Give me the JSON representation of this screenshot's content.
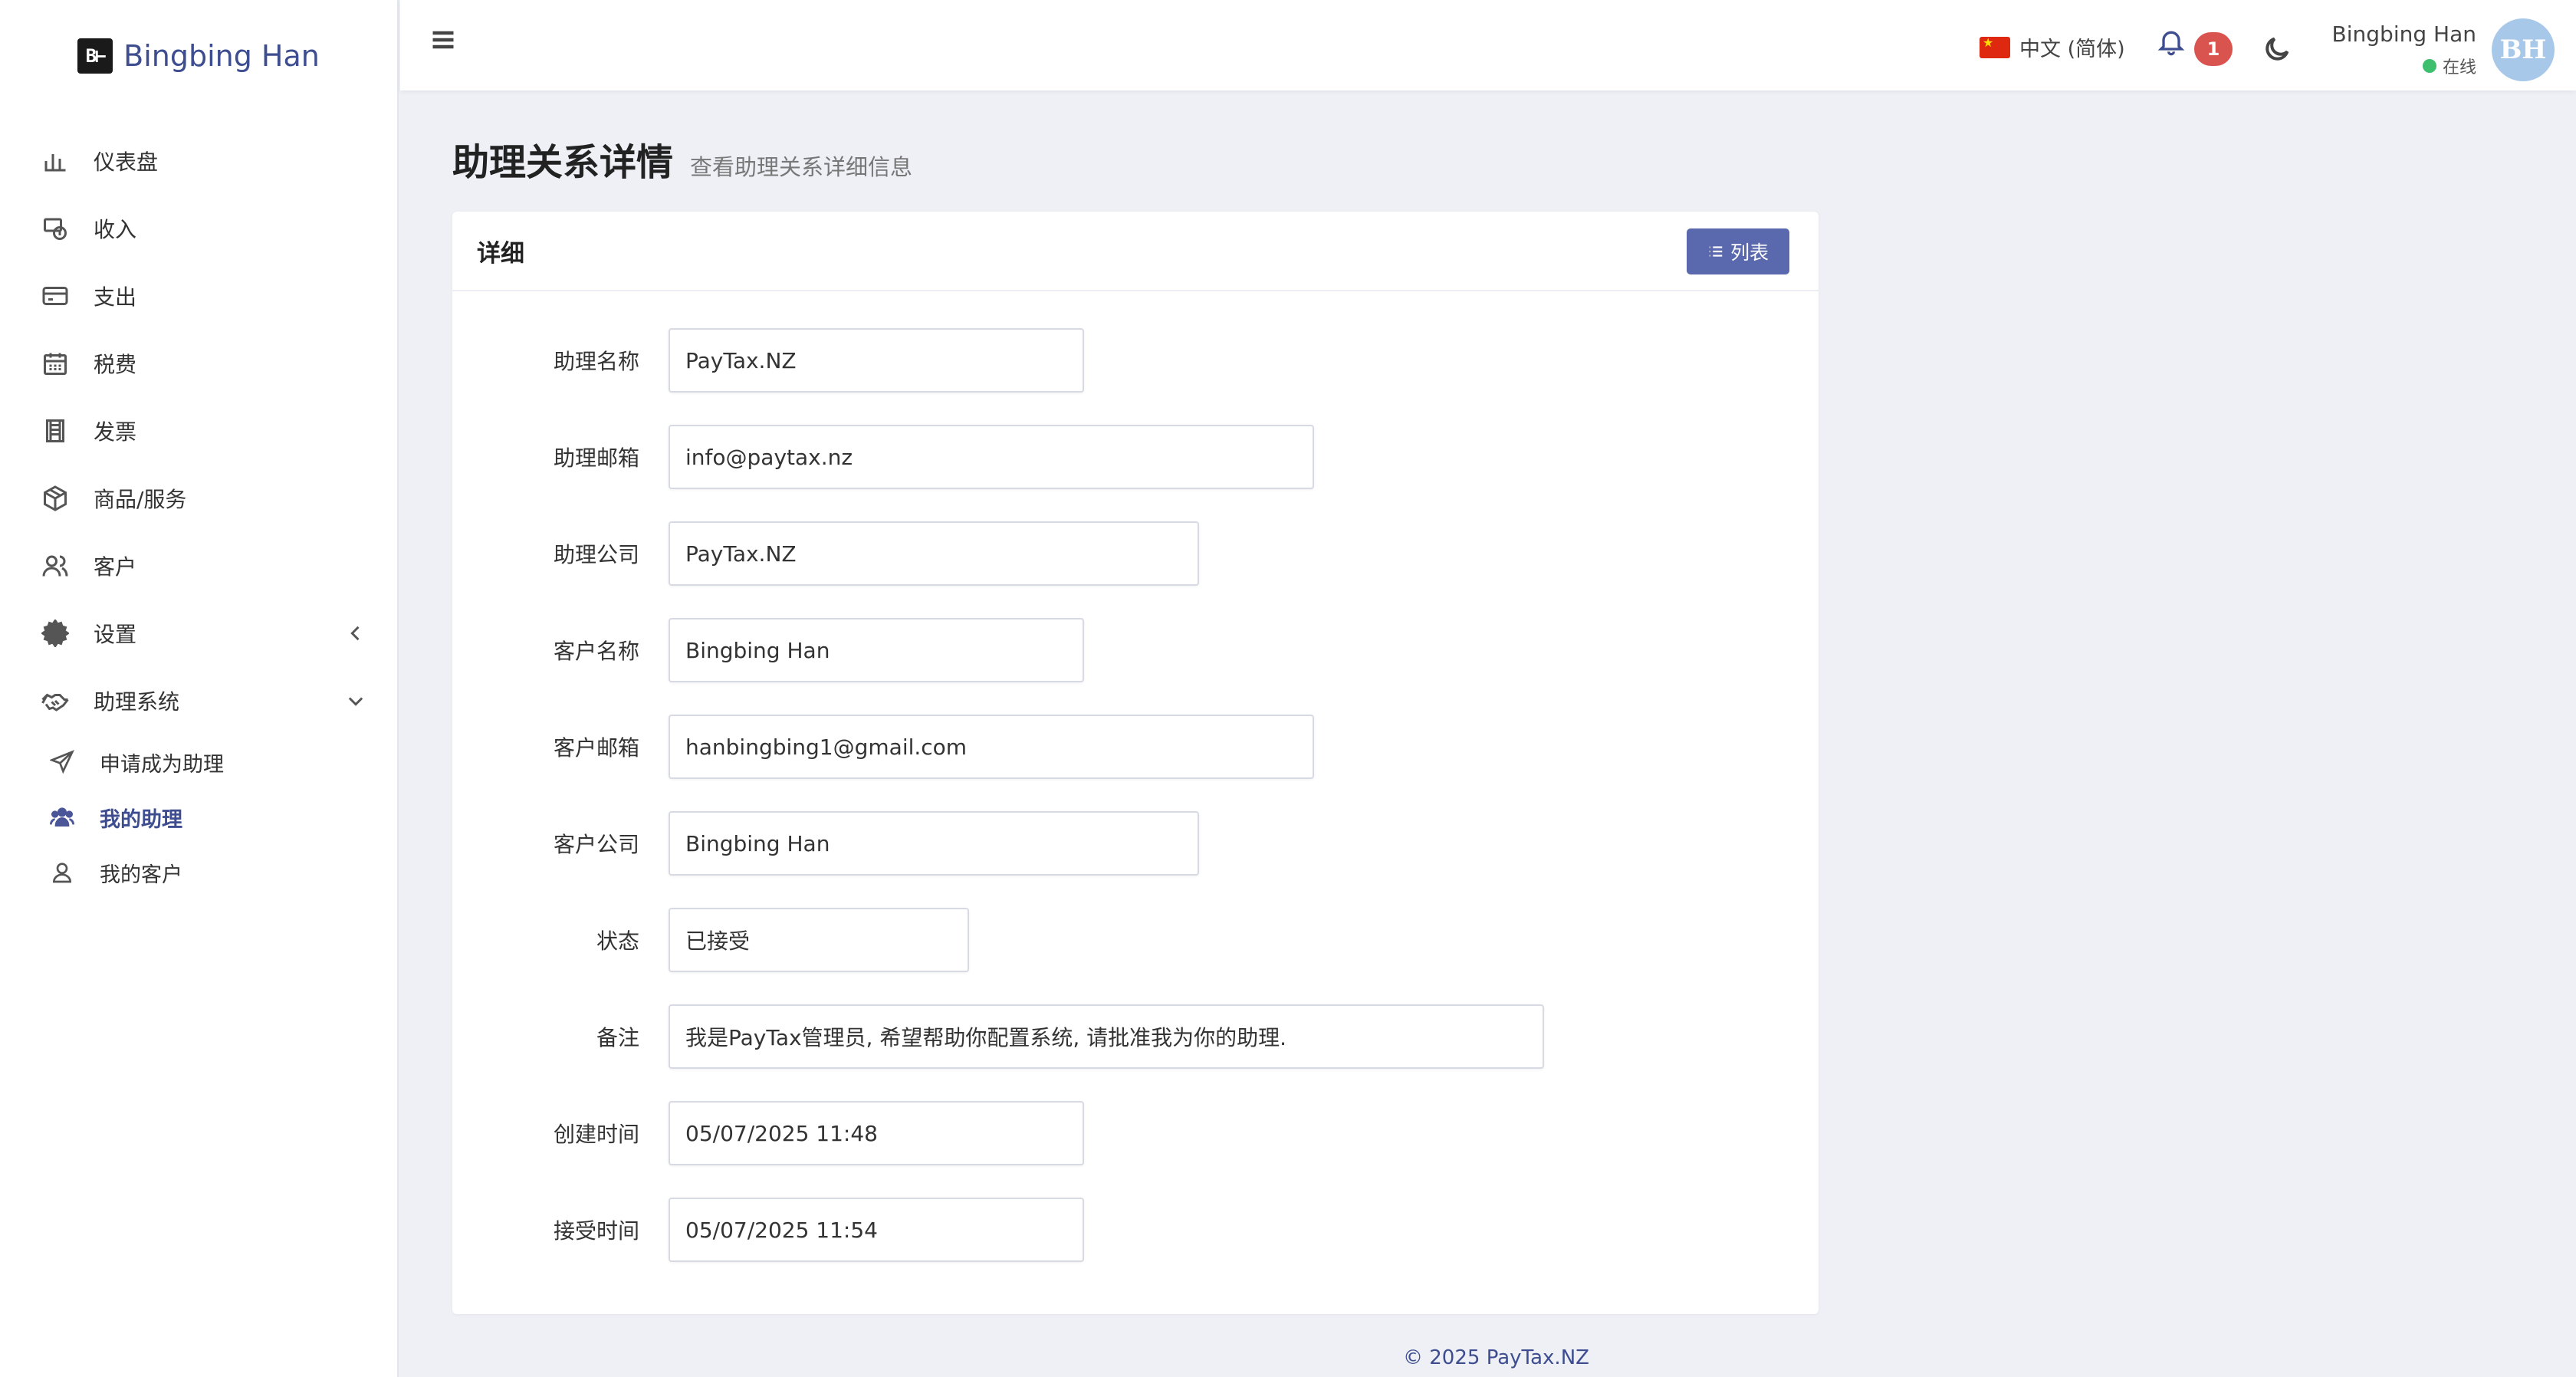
{
  "brand": {
    "logo_text": "B⊢",
    "name": "Bingbing Han"
  },
  "sidebar": {
    "items": [
      {
        "label": "仪表盘",
        "icon": "bar-chart-icon"
      },
      {
        "label": "收入",
        "icon": "income-icon"
      },
      {
        "label": "支出",
        "icon": "credit-card-icon"
      },
      {
        "label": "税费",
        "icon": "calendar-icon"
      },
      {
        "label": "发票",
        "icon": "receipt-icon"
      },
      {
        "label": "商品/服务",
        "icon": "box-icon"
      },
      {
        "label": "客户",
        "icon": "users-icon"
      },
      {
        "label": "设置",
        "icon": "gear-icon"
      },
      {
        "label": "助理系统",
        "icon": "handshake-icon"
      }
    ],
    "sub_items": [
      {
        "label": "申请成为助理",
        "icon": "paper-plane-icon"
      },
      {
        "label": "我的助理",
        "icon": "user-group-icon",
        "active": true
      },
      {
        "label": "我的客户",
        "icon": "user-icon"
      }
    ]
  },
  "topbar": {
    "language": "中文 (简体)",
    "notification_count": "1",
    "user_name": "Bingbing Han",
    "user_status": "在线",
    "avatar_initials": "BH"
  },
  "page": {
    "title": "助理关系详情",
    "subtitle": "查看助理关系详细信息"
  },
  "card": {
    "title": "详细",
    "list_button": "列表"
  },
  "fields": [
    {
      "label": "助理名称",
      "value": "PayTax.NZ"
    },
    {
      "label": "助理邮箱",
      "value": "info@paytax.nz"
    },
    {
      "label": "助理公司",
      "value": "PayTax.NZ"
    },
    {
      "label": "客户名称",
      "value": "Bingbing Han"
    },
    {
      "label": "客户邮箱",
      "value": "hanbingbing1@gmail.com"
    },
    {
      "label": "客户公司",
      "value": "Bingbing Han"
    },
    {
      "label": "状态",
      "value": "已接受"
    },
    {
      "label": "备注",
      "value": "我是PayTax管理员, 希望帮助你配置系统, 请批准我为你的助理."
    },
    {
      "label": "创建时间",
      "value": "05/07/2025 11:48"
    },
    {
      "label": "接受时间",
      "value": "05/07/2025 11:54"
    }
  ],
  "footer": {
    "text": "© 2025 PayTax.NZ"
  },
  "colors": {
    "accent": "#3d4d8f",
    "button": "#5a69ad",
    "badge": "#d9534f",
    "online": "#3dbf6d",
    "background": "#eef0f6"
  }
}
